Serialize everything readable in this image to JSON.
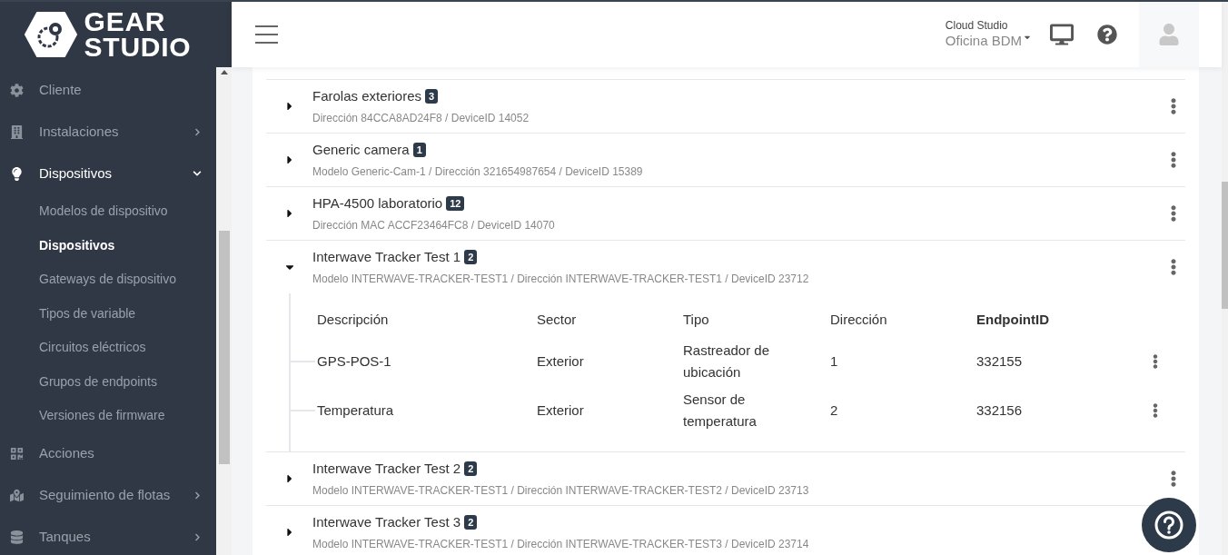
{
  "logo": {
    "line_1": "GEAR",
    "line_2": "STUDIO"
  },
  "sidebar": {
    "items": [
      {
        "kind": "link",
        "label": "Cliente",
        "selected": false
      },
      {
        "kind": "group",
        "label": "Instalaciones",
        "selected": false,
        "expanded": false
      },
      {
        "kind": "group",
        "label": "Dispositivos",
        "selected": true,
        "expanded": true,
        "children": [
          {
            "label": "Modelos de dispositivo",
            "selected": false
          },
          {
            "label": "Dispositivos",
            "selected": true
          },
          {
            "label": "Gateways de dispositivo",
            "selected": false
          },
          {
            "label": "Tipos de variable",
            "selected": false
          },
          {
            "label": "Circuitos eléctricos",
            "selected": false
          },
          {
            "label": "Grupos de endpoints",
            "selected": false
          },
          {
            "label": "Versiones de firmware",
            "selected": false
          }
        ]
      },
      {
        "kind": "link",
        "label": "Acciones",
        "selected": false
      },
      {
        "kind": "group",
        "label": "Seguimiento de flotas",
        "selected": false,
        "expanded": false
      },
      {
        "kind": "group",
        "label": "Tanques",
        "selected": false,
        "expanded": false
      }
    ]
  },
  "header": {
    "org": "Cloud Studio",
    "site": "Oficina BDM"
  },
  "devices": [
    {
      "name": "Farolas exteriores",
      "count": "3",
      "details": "Dirección 84CCA8AD24F8 / DeviceID 14052",
      "expanded": false
    },
    {
      "name": "Generic camera",
      "count": "1",
      "details": "Modelo Generic-Cam-1 / Dirección 321654987654 / DeviceID 15389",
      "expanded": false
    },
    {
      "name": "HPA-4500 laboratorio",
      "count": "12",
      "details": "Dirección MAC ACCF23464FC8 / DeviceID 14070",
      "expanded": false
    },
    {
      "name": "Interwave Tracker Test 1",
      "count": "2",
      "details": "Modelo INTERWAVE-TRACKER-TEST1 / Dirección INTERWAVE-TRACKER-TEST1 / DeviceID 23712",
      "expanded": true,
      "endpoints": {
        "columns": [
          {
            "label": "Descripción",
            "sorted": false
          },
          {
            "label": "Sector",
            "sorted": false
          },
          {
            "label": "Tipo",
            "sorted": false
          },
          {
            "label": "Dirección",
            "sorted": false
          },
          {
            "label": "EndpointID",
            "sorted": true
          }
        ],
        "rows": [
          [
            "GPS-POS-1",
            "Exterior",
            "Rastreador de ubicación",
            "1",
            "332155"
          ],
          [
            "Temperatura",
            "Exterior",
            "Sensor de temperatura",
            "2",
            "332156"
          ]
        ]
      }
    },
    {
      "name": "Interwave Tracker Test 2",
      "count": "2",
      "details": "Modelo INTERWAVE-TRACKER-TEST1 / Dirección INTERWAVE-TRACKER-TEST2 / DeviceID 23713",
      "expanded": false
    },
    {
      "name": "Interwave Tracker Test 3",
      "count": "2",
      "details": "Modelo INTERWAVE-TRACKER-TEST1 / Dirección INTERWAVE-TRACKER-TEST3 / DeviceID 23714",
      "expanded": false
    }
  ]
}
